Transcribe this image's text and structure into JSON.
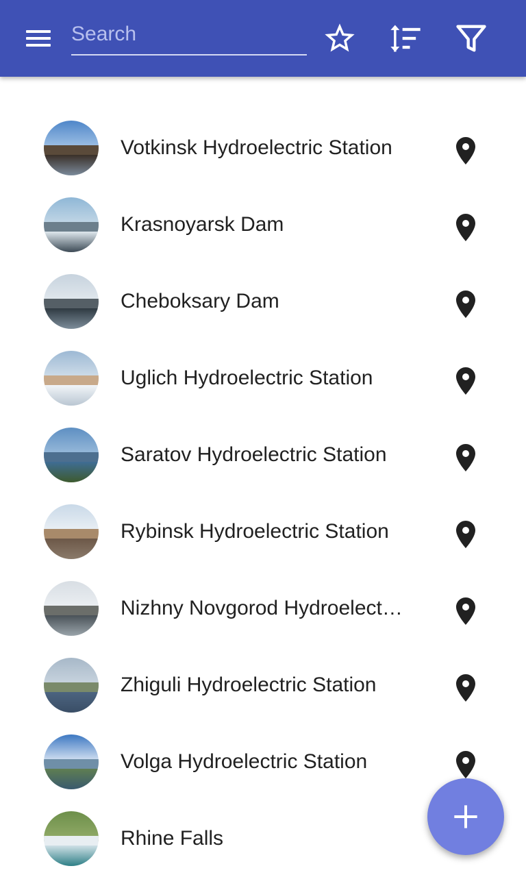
{
  "colors": {
    "app_bar": "#3f51b5",
    "fab": "#717fe0",
    "text": "#212121",
    "icon_dark": "#212121",
    "icon_light": "#ffffff"
  },
  "toolbar": {
    "menu_icon": "menu-icon",
    "search_placeholder": "Search",
    "search_value": "",
    "actions": [
      {
        "icon": "star-outline-icon"
      },
      {
        "icon": "sort-icon"
      },
      {
        "icon": "filter-icon"
      }
    ]
  },
  "items": [
    {
      "title": "Votkinsk Hydroelectric Station",
      "thumbnail": "votkinsk-photo",
      "action_icon": "map-marker-icon"
    },
    {
      "title": "Krasnoyarsk Dam",
      "thumbnail": "krasnoyarsk-photo",
      "action_icon": "map-marker-icon"
    },
    {
      "title": "Cheboksary Dam",
      "thumbnail": "cheboksary-photo",
      "action_icon": "map-marker-icon"
    },
    {
      "title": "Uglich Hydroelectric Station",
      "thumbnail": "uglich-photo",
      "action_icon": "map-marker-icon"
    },
    {
      "title": "Saratov Hydroelectric Station",
      "thumbnail": "saratov-photo",
      "action_icon": "map-marker-icon"
    },
    {
      "title": "Rybinsk Hydroelectric Station",
      "thumbnail": "rybinsk-photo",
      "action_icon": "map-marker-icon"
    },
    {
      "title": "Nizhny Novgorod Hydroelectric Station",
      "thumbnail": "nizhny-novgorod-photo",
      "action_icon": "map-marker-icon"
    },
    {
      "title": "Zhiguli Hydroelectric Station",
      "thumbnail": "zhiguli-photo",
      "action_icon": "map-marker-icon"
    },
    {
      "title": "Volga Hydroelectric Station",
      "thumbnail": "volga-photo",
      "action_icon": "map-marker-icon"
    },
    {
      "title": "Rhine Falls",
      "thumbnail": "rhine-falls-photo",
      "action_icon": "map-marker-icon"
    }
  ],
  "fab": {
    "icon": "add-icon"
  }
}
